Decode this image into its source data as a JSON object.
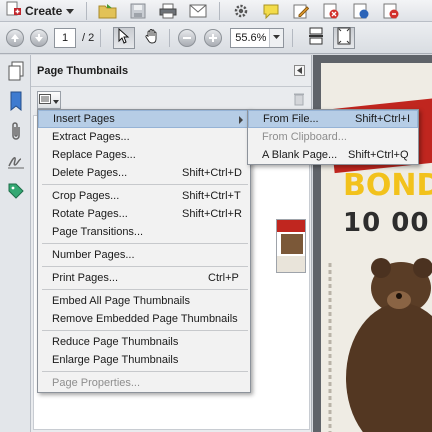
{
  "toolbar": {
    "create_label": "Create",
    "icons": [
      "create-icon",
      "open-icon",
      "save-icon",
      "print-icon",
      "email-icon",
      "gear-icon",
      "comment-icon",
      "edit-icon",
      "sign-icon",
      "share-icon",
      "stamp-icon"
    ]
  },
  "navbar": {
    "current_page": "1",
    "total_pages": "/ 2",
    "zoom": "55.6%"
  },
  "panel": {
    "title": "Page Thumbnails"
  },
  "options_menu": {
    "insert_pages": "Insert Pages",
    "extract_pages": "Extract Pages...",
    "replace_pages": "Replace Pages...",
    "delete_pages": "Delete Pages...",
    "delete_shortcut": "Shift+Ctrl+D",
    "crop_pages": "Crop Pages...",
    "crop_shortcut": "Shift+Ctrl+T",
    "rotate_pages": "Rotate Pages...",
    "rotate_shortcut": "Shift+Ctrl+R",
    "page_transitions": "Page Transitions...",
    "number_pages": "Number Pages...",
    "print_pages": "Print Pages...",
    "print_shortcut": "Ctrl+P",
    "embed_thumbs": "Embed All Page Thumbnails",
    "remove_thumbs": "Remove Embedded Page Thumbnails",
    "reduce_thumbs": "Reduce Page Thumbnails",
    "enlarge_thumbs": "Enlarge Page Thumbnails",
    "page_properties": "Page Properties..."
  },
  "insert_submenu": {
    "from_file": "From File...",
    "from_file_shortcut": "Shift+Ctrl+I",
    "from_clipboard": "From Clipboard...",
    "blank_page": "A Blank Page...",
    "blank_shortcut": "Shift+Ctrl+Q"
  },
  "document": {
    "headline": "10 00",
    "banner_text": "BOND"
  }
}
